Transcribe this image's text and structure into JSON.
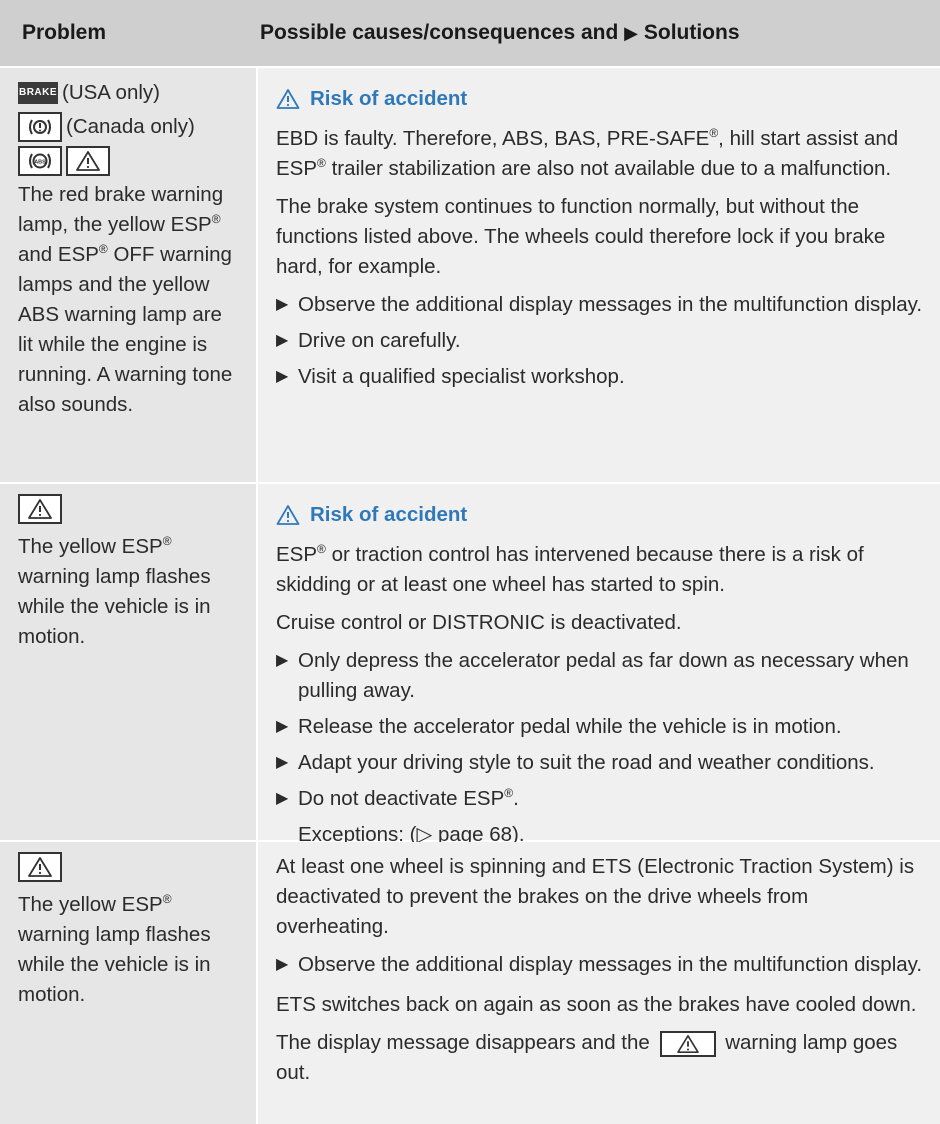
{
  "header": {
    "col1": "Problem",
    "col2_prefix": "Possible causes/consequences and",
    "col2_suffix": "Solutions"
  },
  "rows": [
    {
      "lamps": {
        "brake_badge": "BRAKE",
        "usa": "(USA only)",
        "canada": "(Canada only)"
      },
      "problem": "The red brake warning lamp, the yellow ESP® and ESP® OFF warning lamps and the yellow ABS warning lamp are lit while the engine is running. A warning tone also sounds.",
      "warning": "Risk of accident",
      "paragraphs": [
        "EBD is faulty. Therefore, ABS, BAS, PRE-SAFE®, hill start assist and ESP® trailer stabilization are also not available due to a malfunction.",
        "The brake system continues to function normally, but without the functions listed above. The wheels could therefore lock if you brake hard, for example."
      ],
      "bullets": [
        "Observe the additional display messages in the multifunction display.",
        "Drive on carefully.",
        "Visit a qualified specialist workshop."
      ]
    },
    {
      "problem": "The yellow ESP® warning lamp flashes while the vehicle is in motion.",
      "warning": "Risk of accident",
      "paragraphs": [
        "ESP® or traction control has intervened because there is a risk of skidding or at least one wheel has started to spin.",
        "Cruise control or DISTRONIC is deactivated."
      ],
      "bullets": [
        "Only depress the accelerator pedal as far down as necessary when pulling away.",
        "Release the accelerator pedal while the vehicle is in motion.",
        "Adapt your driving style to suit the road and weather conditions.",
        "Do not deactivate ESP®."
      ],
      "exceptions": "Exceptions: (▷ page 68)."
    },
    {
      "problem": "The yellow ESP® warning lamp flashes while the vehicle is in motion.",
      "paragraphs_before": [
        "At least one wheel is spinning and ETS (Electronic Traction System) is deactivated to prevent the brakes on the drive wheels from overheating."
      ],
      "bullets": [
        "Observe the additional display messages in the multifunction display."
      ],
      "paragraphs_after": [
        "ETS switches back on again as soon as the brakes have cooled down."
      ],
      "last_before": "The display message disappears and the",
      "last_after": "warning lamp goes out."
    }
  ]
}
